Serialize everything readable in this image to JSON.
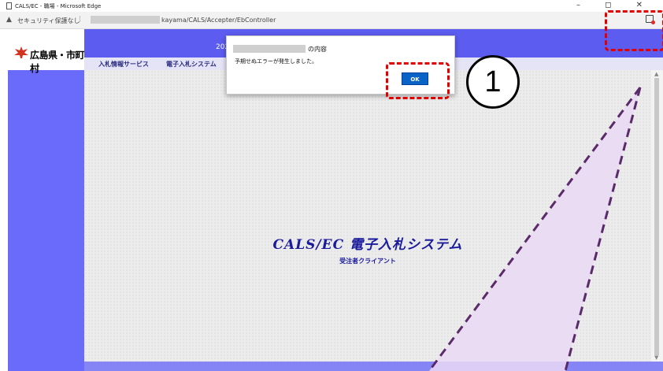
{
  "browser": {
    "window_title": "CALS/EC - 職場 - Microsoft Edge",
    "window_buttons": "– ◻ ✕",
    "security_label": "セキュリティ保護なし",
    "separator": "|",
    "url_visible": "kayama/CALS/Accepter/EbController"
  },
  "page": {
    "logo_text": "広島県・市町村",
    "year_fragment": "202",
    "menu": [
      "入札情報サービス",
      "電子入札システム"
    ],
    "system_title": "CALS/EC 電子入札システム",
    "system_subtitle": "受注者クライアント"
  },
  "dialog": {
    "title_suffix": "の内容",
    "message": "予期せぬエラーが発生しました。",
    "ok_label": "OK"
  },
  "annotation": {
    "callout_number": "1",
    "highlight_color": "#e00000",
    "pointer_color": "#5a2a6a",
    "pointer_fill": "#ead9f4"
  },
  "colors": {
    "page_bg": "#6b6bfb",
    "header_bg": "#5c5cf0",
    "ok_button": "#0a64c8",
    "title_text": "#1a1a9c"
  }
}
